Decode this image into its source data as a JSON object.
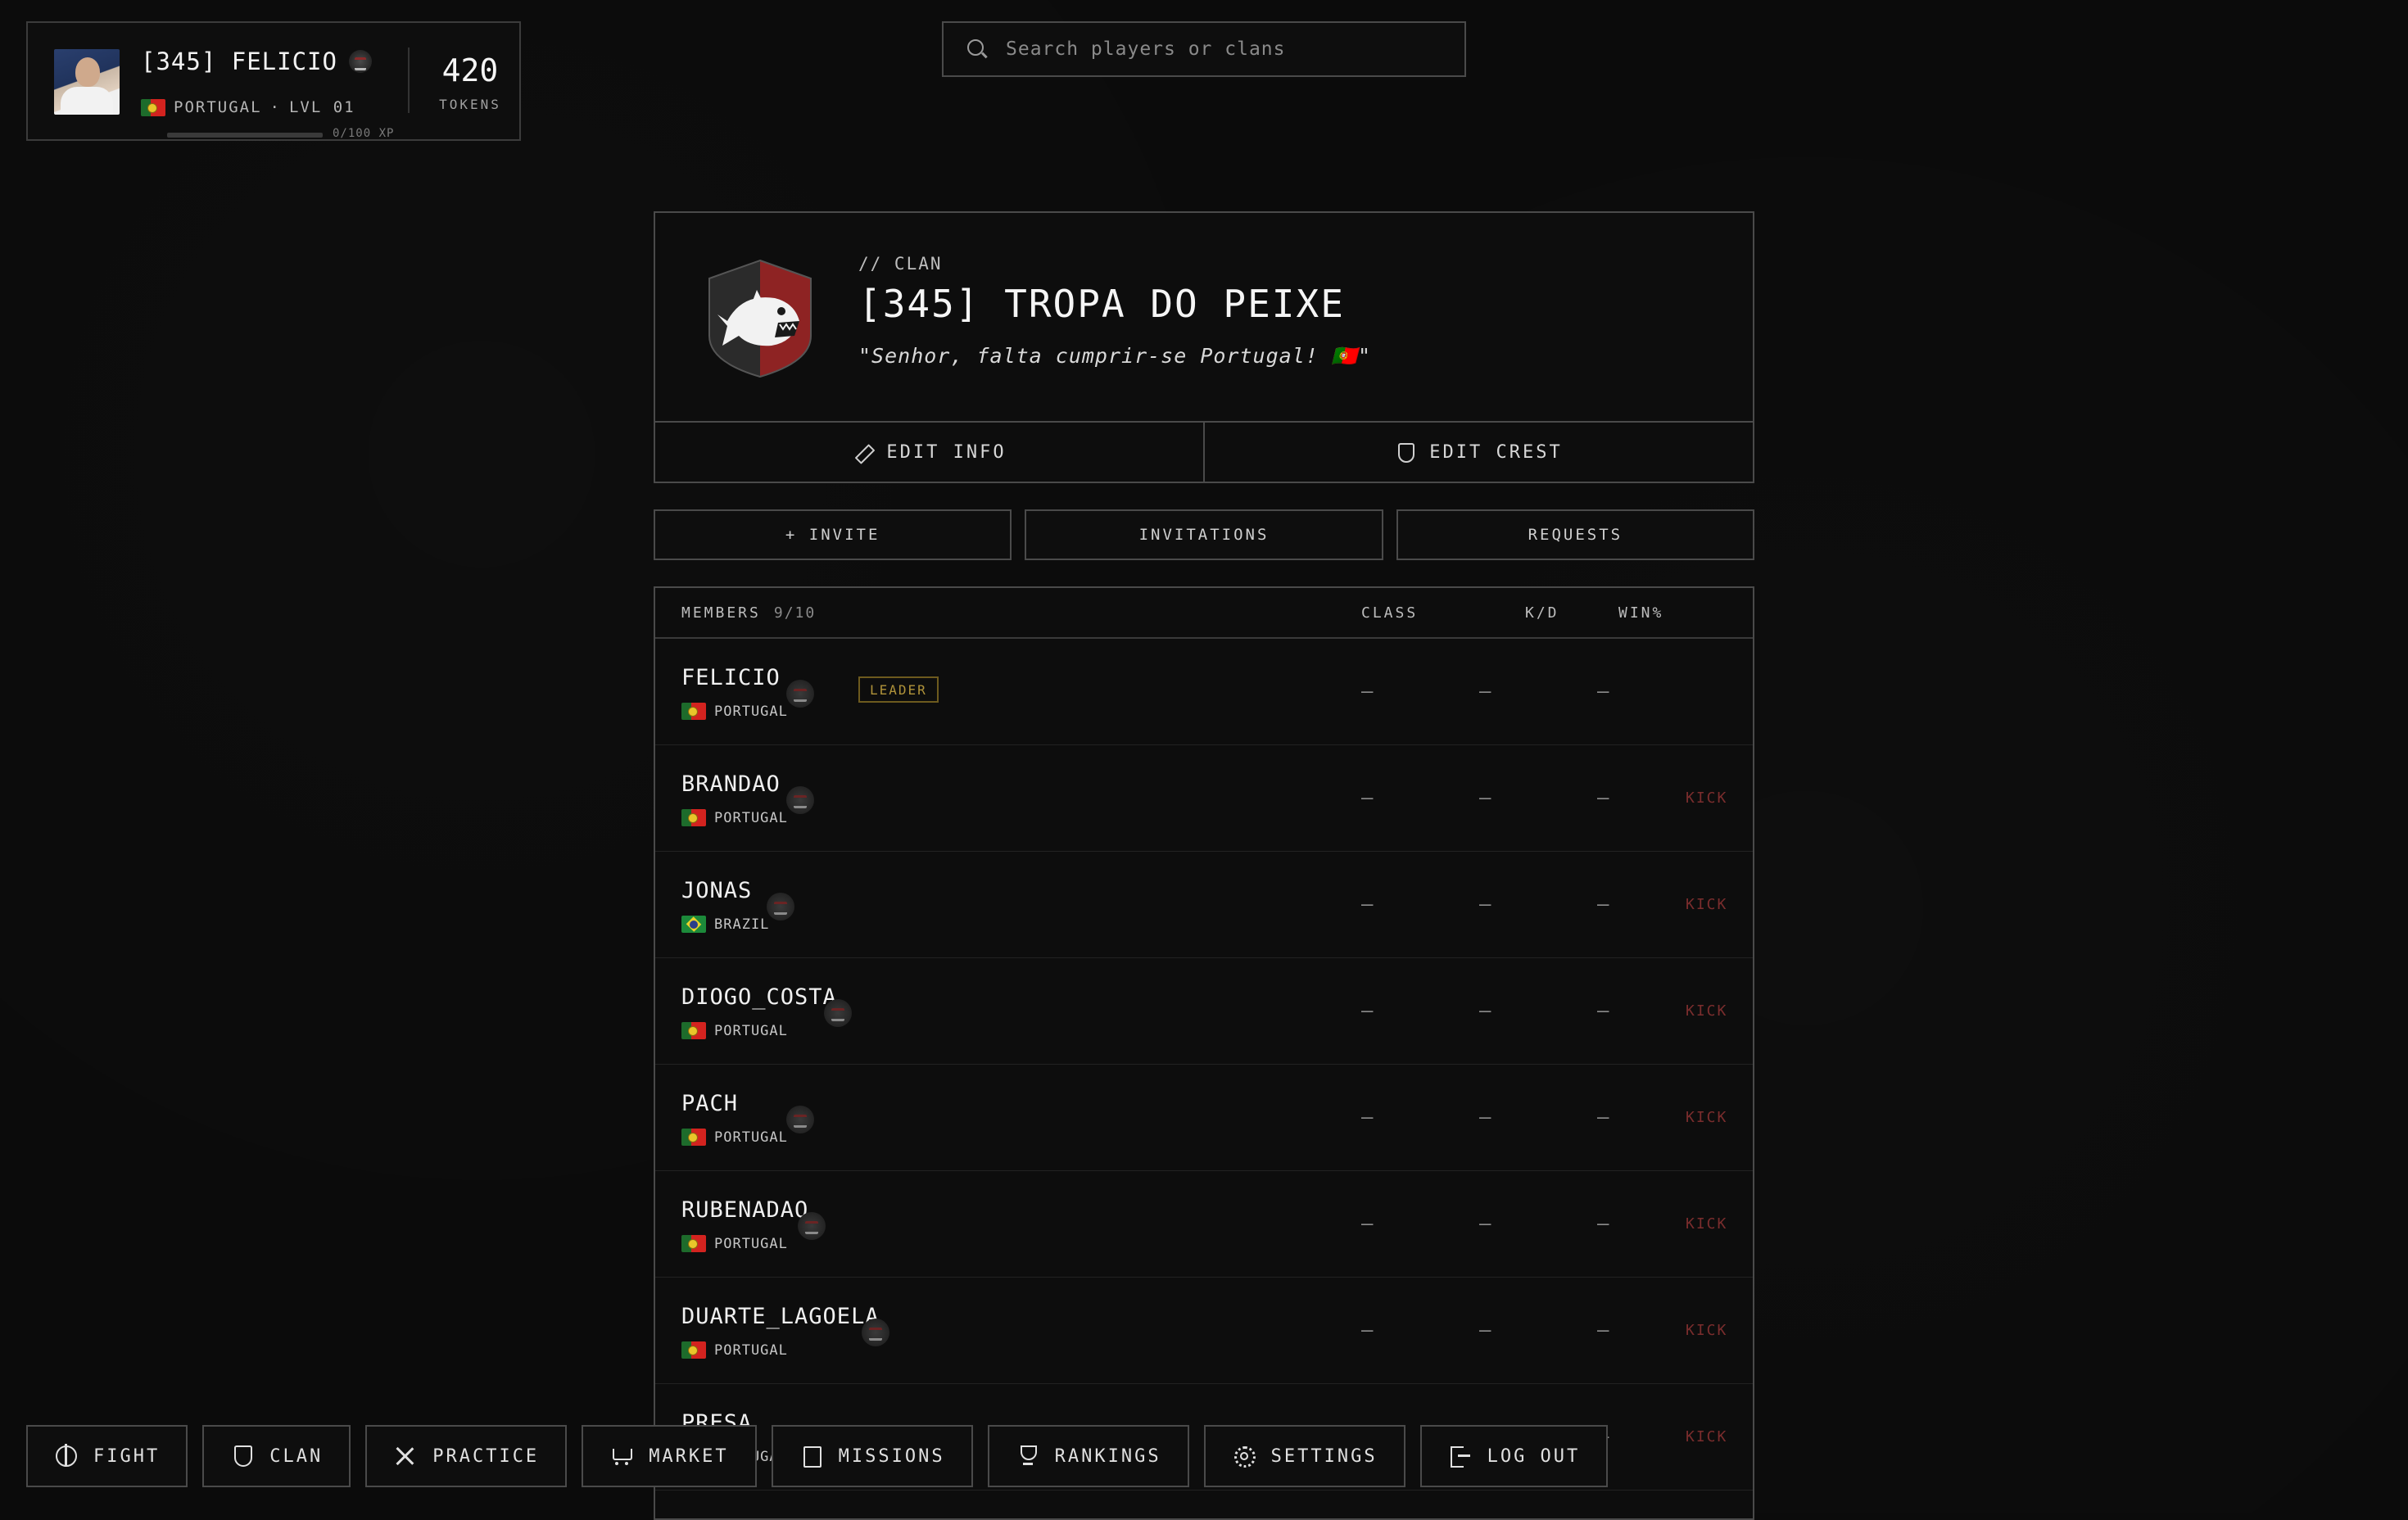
{
  "player": {
    "name": "[345] FELICIO",
    "country": "PORTUGAL",
    "level": "LVL 01",
    "meta_separator": "·",
    "xp_text": "0/100 XP",
    "xp_progress": 0,
    "tokens_value": "420",
    "tokens_label": "TOKENS"
  },
  "search": {
    "placeholder": "Search players or clans",
    "value": ""
  },
  "clan": {
    "kicker": "// CLAN",
    "name": "[345] TROPA DO PEIXE",
    "motto": "\"Senhor, falta cumprir-se Portugal! 🇵🇹\"",
    "edit_info_label": "EDIT INFO",
    "edit_crest_label": "EDIT CREST",
    "crest_colors": {
      "red": "#8e2323",
      "dark": "#2b2b2b",
      "white": "#f2f2f2"
    }
  },
  "actions": {
    "invite_label": "+ INVITE",
    "invitations_label": "INVITATIONS",
    "requests_label": "REQUESTS"
  },
  "members": {
    "title": "MEMBERS",
    "count": "9/10",
    "columns": {
      "class": "CLASS",
      "kd": "K/D",
      "win": "WIN%"
    },
    "empty_value": "—",
    "kick_label": "KICK",
    "leader_label": "LEADER",
    "rows": [
      {
        "name": "FELICIO",
        "country": "PORTUGAL",
        "flag": "pt",
        "leader": true
      },
      {
        "name": "BRANDAO",
        "country": "PORTUGAL",
        "flag": "pt",
        "leader": false
      },
      {
        "name": "JONAS",
        "country": "BRAZIL",
        "flag": "br",
        "leader": false
      },
      {
        "name": "DIOGO_COSTA",
        "country": "PORTUGAL",
        "flag": "pt",
        "leader": false
      },
      {
        "name": "PACH",
        "country": "PORTUGAL",
        "flag": "pt",
        "leader": false
      },
      {
        "name": "RUBENADAO",
        "country": "PORTUGAL",
        "flag": "pt",
        "leader": false
      },
      {
        "name": "DUARTE_LAGOELA",
        "country": "PORTUGAL",
        "flag": "pt",
        "leader": false
      },
      {
        "name": "PRESA",
        "country": "PORTUGAL",
        "flag": "pt",
        "leader": false
      }
    ]
  },
  "nav": [
    {
      "label": "FIGHT",
      "icon": "crosshair-icon"
    },
    {
      "label": "CLAN",
      "icon": "shield-icon"
    },
    {
      "label": "PRACTICE",
      "icon": "swords-icon"
    },
    {
      "label": "MARKET",
      "icon": "cart-icon"
    },
    {
      "label": "MISSIONS",
      "icon": "scroll-icon"
    },
    {
      "label": "RANKINGS",
      "icon": "trophy-icon"
    },
    {
      "label": "SETTINGS",
      "icon": "gear-icon"
    },
    {
      "label": "LOG OUT",
      "icon": "logout-icon"
    }
  ],
  "colors": {
    "background": "#0b0b0b",
    "border": "#4a4a4a",
    "leader_badge": "#b0933a",
    "kick": "#7a2d2d"
  }
}
